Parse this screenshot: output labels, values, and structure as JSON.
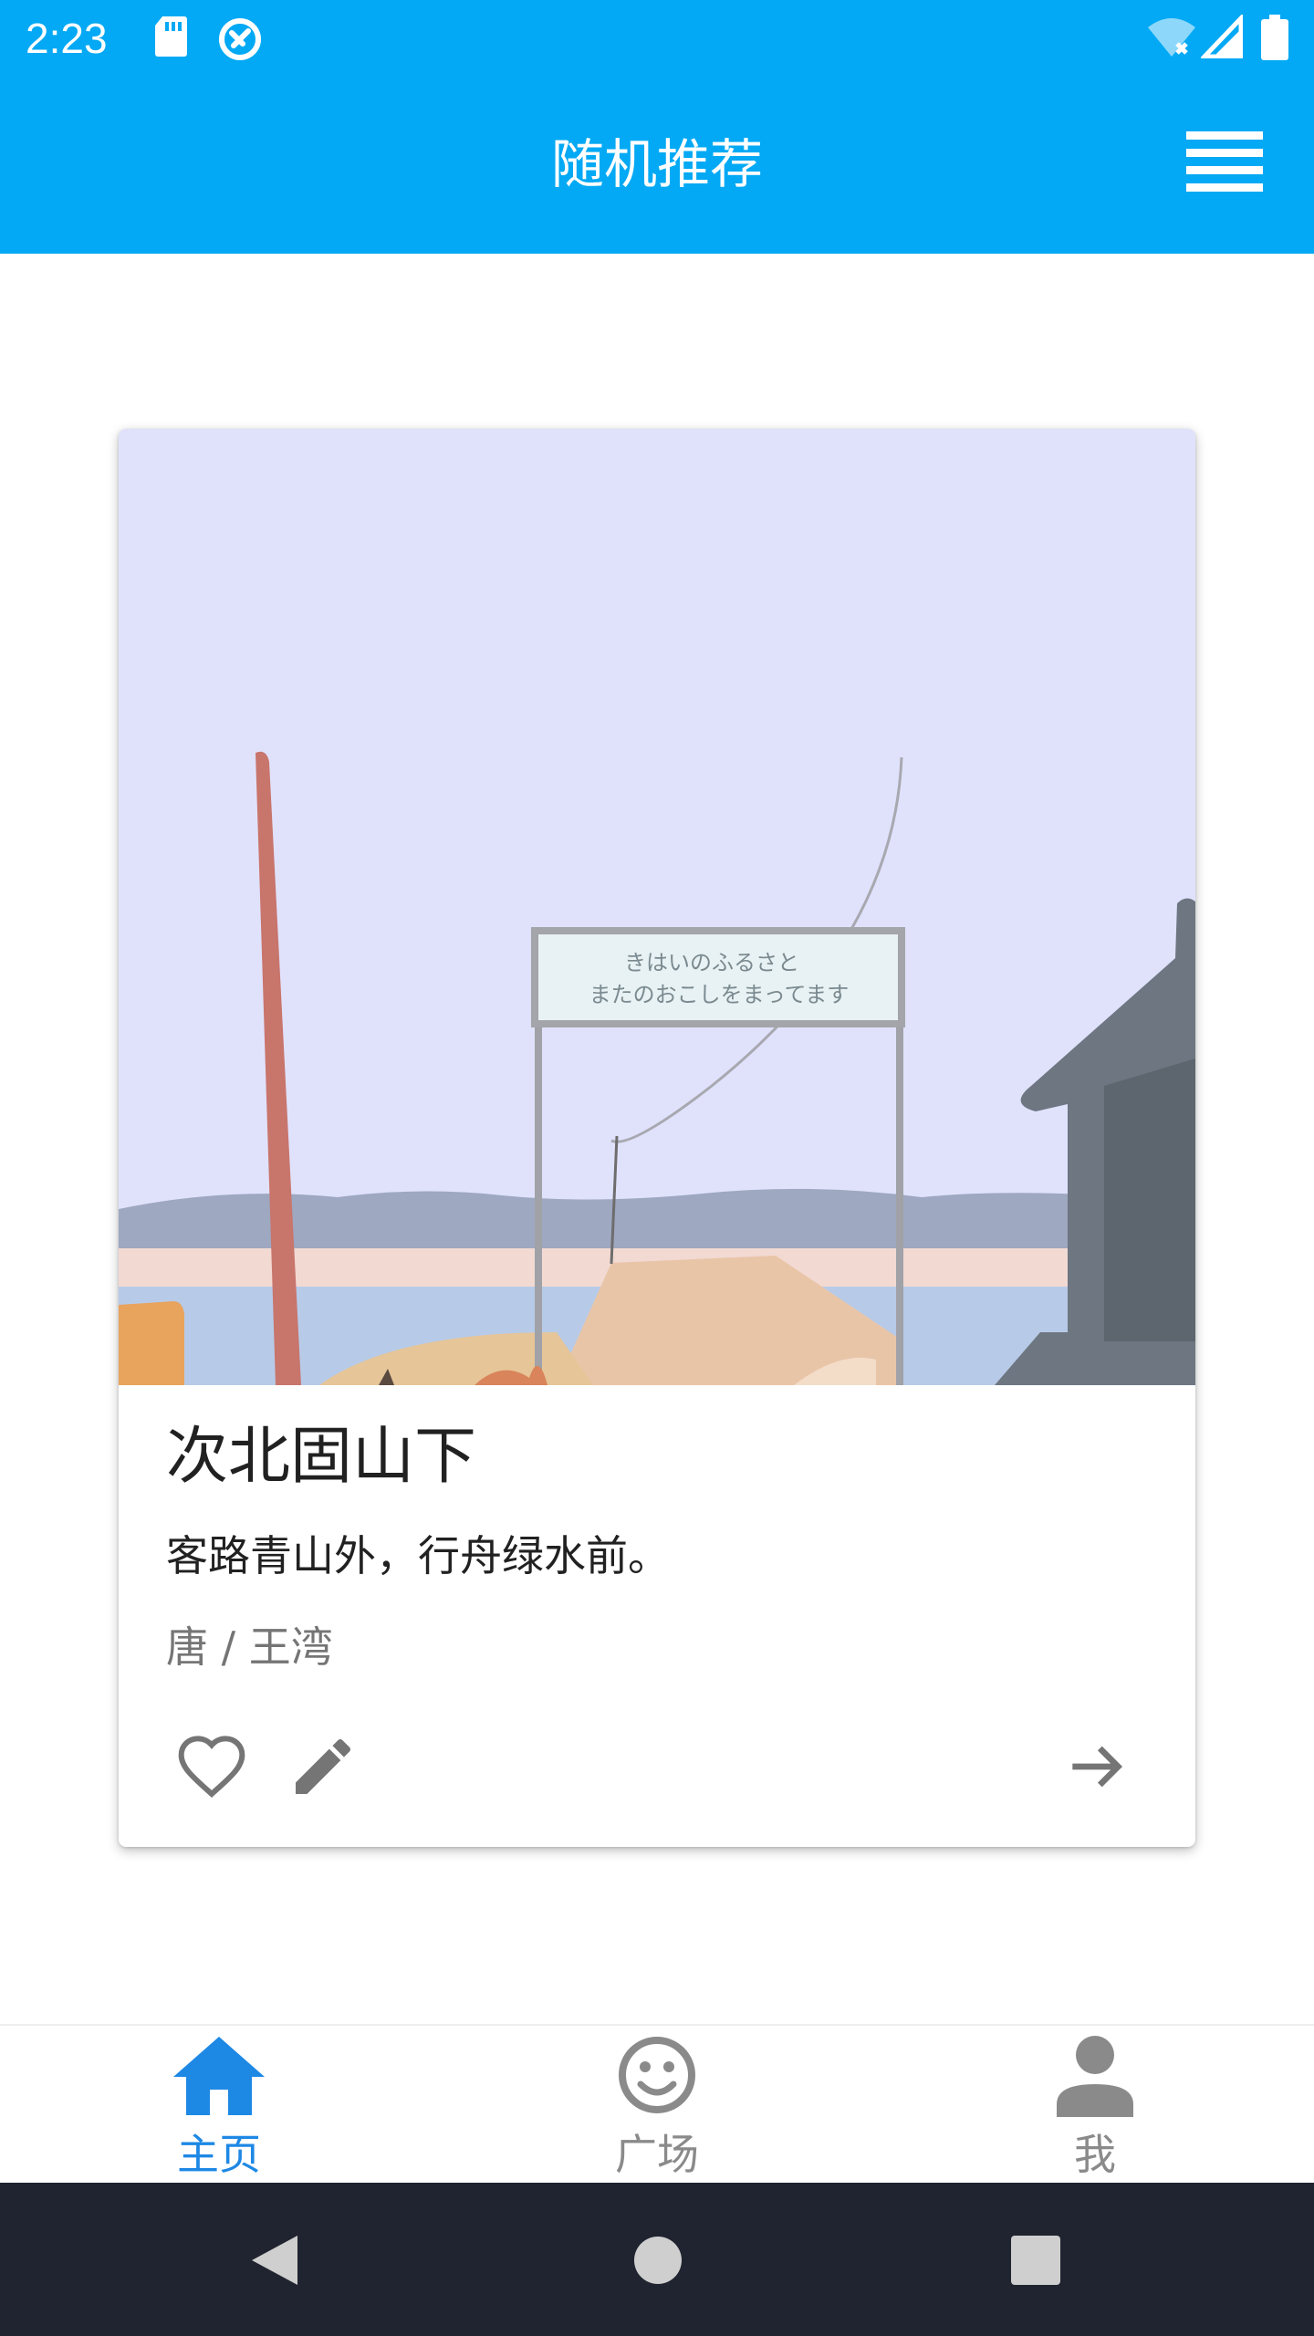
{
  "status_bar": {
    "time": "2:23",
    "icons": [
      "sd-card-icon",
      "sync-icon",
      "wifi-icon",
      "signal-icon",
      "battery-icon"
    ]
  },
  "app_bar": {
    "title": "随机推荐",
    "menu_icon": "menu-icon"
  },
  "poem_card": {
    "image": "illustration-seaside-station",
    "sign_text_line1": "きはいのふるさと",
    "sign_text_line2": "またのおこしをまってます",
    "title": "次北固山下",
    "verse": "客路青山外，行舟绿水前。",
    "author": "唐 / 王湾",
    "actions": {
      "favorite_icon": "heart-outline-icon",
      "edit_icon": "pencil-icon",
      "next_icon": "arrow-right-icon"
    }
  },
  "bottom_nav": {
    "items": [
      {
        "label": "主页",
        "icon": "home-icon",
        "active": true
      },
      {
        "label": "广场",
        "icon": "smiley-icon",
        "active": false
      },
      {
        "label": "我",
        "icon": "person-icon",
        "active": false
      }
    ]
  },
  "system_nav": {
    "icons": [
      "back-icon",
      "home-circle-icon",
      "recents-icon"
    ]
  },
  "colors": {
    "primary": "#03a9f4",
    "active_nav": "#1e88e5",
    "inactive_nav": "#8a8a8a",
    "system_nav_bg": "#202430"
  }
}
